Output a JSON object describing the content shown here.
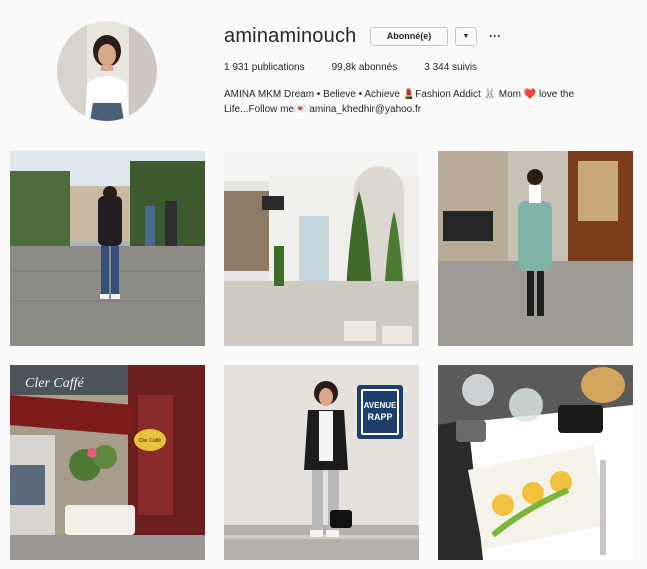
{
  "profile": {
    "username": "aminaminouch",
    "follow_label": "Abonné(e)",
    "dropdown_icon": "chevron-down-icon",
    "more_icon": "ellipsis-icon",
    "more_label": "···",
    "stats": {
      "posts": "1 931 publications",
      "followers": "99,8k abonnés",
      "following": "3 344 suivis"
    },
    "bio": {
      "name": "AMINA MKM",
      "line1": " Dream • Believe • Achieve 💄Fashion Addict 🐰 Mom ❤️ love the",
      "line2": "Life...Follow me💌 amina_khedhir@yahoo.fr"
    }
  },
  "posts": [
    {
      "alt": "street-outfit-photo",
      "sign": ""
    },
    {
      "alt": "storefront-topiary-photo",
      "sign": ""
    },
    {
      "alt": "trench-coat-street-photo",
      "sign": ""
    },
    {
      "alt": "cafe-terrace-photo",
      "sign": "Cler Caffé"
    },
    {
      "alt": "avenue-rapp-photo",
      "sign": "AVENUE RAPP"
    },
    {
      "alt": "food-table-photo",
      "sign": ""
    }
  ],
  "colors": {
    "background": "#fafafa",
    "text": "#262626",
    "border": "#c7c7c7"
  }
}
